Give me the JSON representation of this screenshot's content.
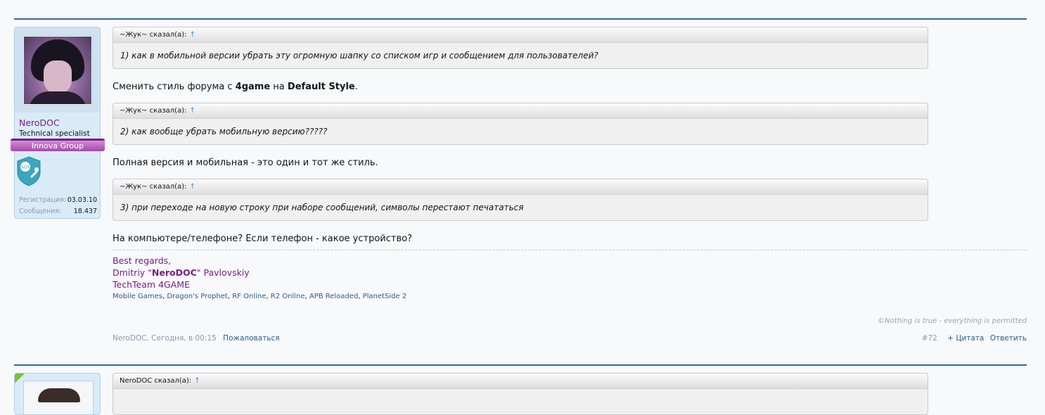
{
  "user": {
    "name": "NeroDOC",
    "title": "Technical specialist",
    "group": "Innova Group",
    "stats": [
      {
        "label": "Регистрация:",
        "value": "03.03.10"
      },
      {
        "label": "Сообщения:",
        "value": "18.437"
      }
    ]
  },
  "quotes": [
    {
      "author": "~Жук~ сказал(а):",
      "arrow": "↑",
      "text": "1) как в мобильной версии убрать эту огромную шапку со списком игр и сообщением для пользователей?"
    },
    {
      "author": "~Жук~ сказал(а):",
      "arrow": "↑",
      "text": "2) как вообще убрать мобильную версию?????"
    },
    {
      "author": "~Жук~ сказал(а):",
      "arrow": "↑",
      "text": "3) при переходе на новую строку при наборе сообщений, символы перестают печататься"
    }
  ],
  "replies": {
    "r1_pre": "Сменить стиль форума с ",
    "r1_b1": "4game",
    "r1_mid": " на ",
    "r1_b2": "Default Style",
    "r1_post": ".",
    "r2": "Полная версия и мобильная - это один и тот же стиль.",
    "r3": "На компьютере/телефоне? Если телефон - какое устройство?"
  },
  "signature": {
    "line1": "Best regards,",
    "line2_pre": "Dmitriy \"",
    "line2_bold": "NeroDOC",
    "line2_post": "\" Pavlovskiy",
    "line3": "TechTeam 4GAME",
    "links": [
      "Mobile Games",
      "Dragon's Prophet",
      "RF Online",
      "R2 Online",
      "APB Reloaded",
      "PlanetSide 2"
    ],
    "link_sep": ",",
    "motto": "©Nothing is true - everything is permitted"
  },
  "post": {
    "meta": "NeroDOC, Сегодня, в 00:15",
    "report": "Пожаловаться",
    "number": "#72",
    "quote_btn": "+ Цитата",
    "reply_btn": "Ответить"
  },
  "next_post": {
    "quote_author": "NeroDOC сказал(а):",
    "arrow": "↑"
  },
  "colors": {
    "accent": "#2c6aa8",
    "username": "#7a1a8c",
    "link": "#2c5c8c"
  }
}
